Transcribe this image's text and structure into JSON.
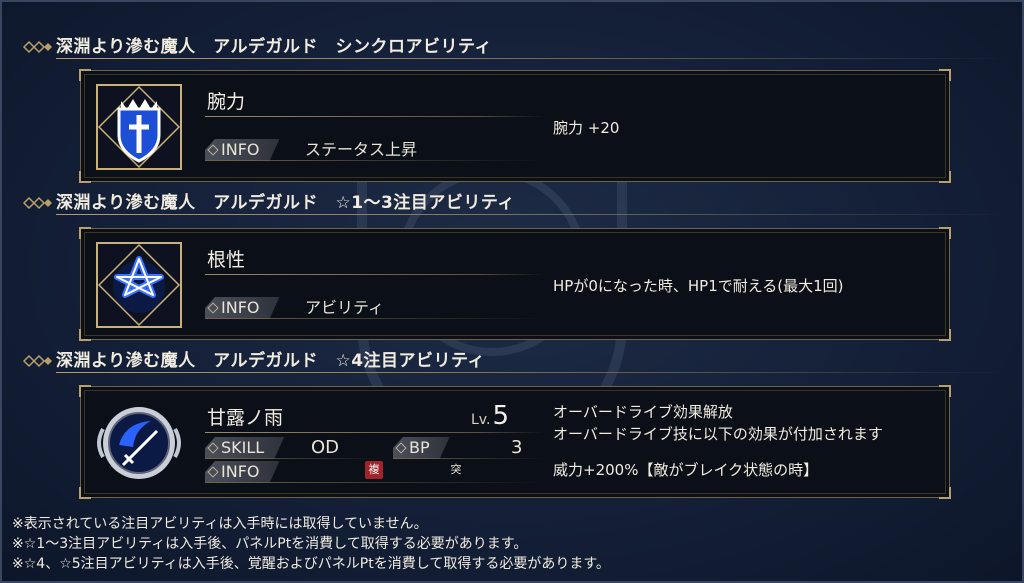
{
  "sections": [
    {
      "title": "深淵より滲む魔人　アルデガルド　シンクロアビリティ"
    },
    {
      "title": "深淵より滲む魔人　アルデガルド　☆1～3注目アビリティ"
    },
    {
      "title": "深淵より滲む魔人　アルデガルド　☆4注目アビリティ"
    }
  ],
  "cards": [
    {
      "name": "腕力",
      "info_label": "INFO",
      "info_value": "ステータス上昇",
      "desc": [
        "腕力 +20"
      ],
      "icon": "shield-crest-icon"
    },
    {
      "name": "根性",
      "info_label": "INFO",
      "info_value": "アビリティ",
      "desc": [
        "HPが0になった時、HP1で耐える(最大1回)"
      ],
      "icon": "triquetra-knot-icon"
    },
    {
      "name": "甘露ノ雨",
      "lv_label": "Lv.",
      "lv_value": "5",
      "skill_label": "SKILL",
      "skill_value": "OD",
      "bp_label": "BP",
      "bp_value": "3",
      "info_label": "INFO",
      "badge_fuku": "複",
      "badge_totsu": "突",
      "desc": [
        "オーバードライブ効果解放",
        "オーバードライブ技に以下の効果が付加されます",
        "威力+200%【敵がブレイク状態の時】"
      ],
      "icon": "sword-skill-icon"
    }
  ],
  "notes": [
    "※表示されている注目アビリティは入手時には取得していません。",
    "※☆1～3注目アビリティは入手後、パネルPtを消費して取得する必要があります。",
    "※☆4、☆5注目アビリティは入手後、覚醒およびパネルPtを消費して取得する必要があります。"
  ],
  "colors": {
    "accent_gold": "#b9a06a",
    "icon_blue": "#1d4fd6",
    "badge_red": "#a2232a"
  }
}
